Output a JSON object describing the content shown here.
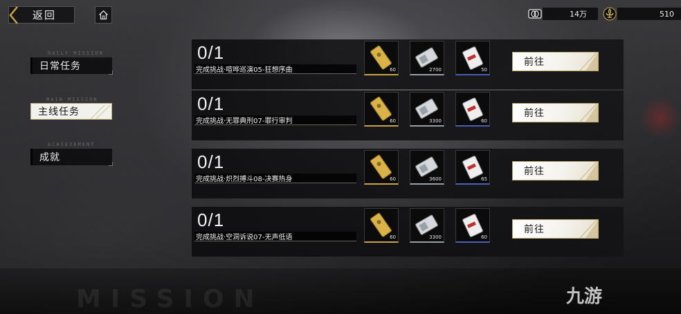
{
  "topbar": {
    "back_label": "返回",
    "currency_1": {
      "icon": "ticket-coin-icon",
      "value": "14万"
    },
    "currency_2": {
      "icon": "fleur-emblem-icon",
      "value": "510"
    }
  },
  "nav": [
    {
      "label": "日常任务",
      "sub": "DAILY MISSION",
      "active": false
    },
    {
      "label": "主线任务",
      "sub": "MAIN MISSION",
      "active": true
    },
    {
      "label": "成就",
      "sub": "ACHIEVEMENT",
      "active": false
    }
  ],
  "missions": [
    {
      "progress_done": "0",
      "progress_total": "1",
      "title": "完成挑战·喧哗巡演05-狂想序曲",
      "rewards": [
        "60",
        "2700",
        "50"
      ],
      "button": "前往"
    },
    {
      "progress_done": "0",
      "progress_total": "1",
      "title": "完成挑战·无罪典刑07-罪行审判",
      "rewards": [
        "60",
        "3300",
        "60"
      ],
      "button": "前往"
    },
    {
      "progress_done": "0",
      "progress_total": "1",
      "title": "完成挑战·炽烈搏斗08-决赛热身",
      "rewards": [
        "60",
        "3600",
        "65"
      ],
      "button": "前往"
    },
    {
      "progress_done": "0",
      "progress_total": "1",
      "title": "完成挑战·空洞诉说07-无声低语",
      "rewards": [
        "60",
        "3300",
        "60"
      ],
      "button": "前往"
    }
  ],
  "reward_icons": [
    "gold-ticket-icon",
    "silver-card-icon",
    "red-white-pack-icon"
  ],
  "watermark": "MISSION",
  "brand": "九游",
  "colors": {
    "gold": "#c9a545",
    "blue": "#4a5fb8",
    "panel": "#0c0c0e"
  }
}
